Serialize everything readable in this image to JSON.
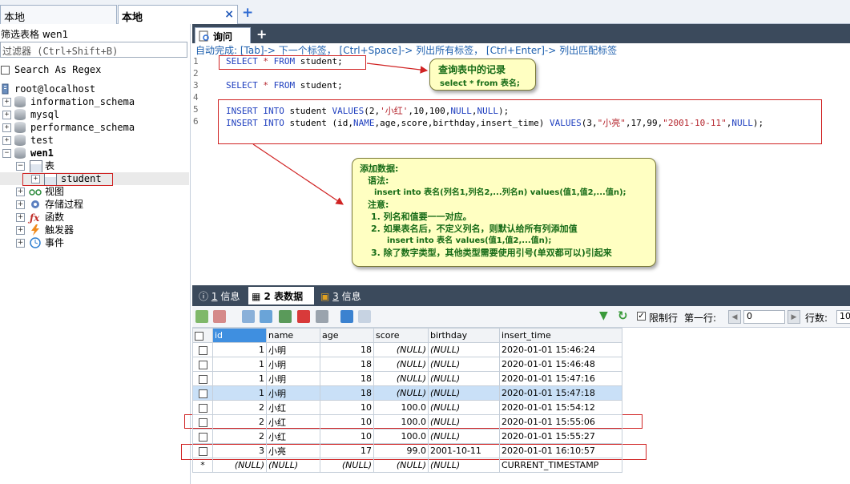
{
  "top_tabs": [
    {
      "label": "本地"
    },
    {
      "label": "本地",
      "close": "×"
    }
  ],
  "top_add": "+",
  "left": {
    "filter_label": "筛选表格 wen1",
    "filter_placeholder": "过滤器 (Ctrl+Shift+B)",
    "regex_label": "Search As Regex",
    "tree": {
      "root": "root@localhost",
      "dbs": [
        "information_schema",
        "mysql",
        "performance_schema",
        "test",
        "wen1"
      ],
      "tables_folder": "表",
      "table": "student",
      "folders": [
        "视图",
        "存储过程",
        "函数",
        "触发器",
        "事件"
      ]
    }
  },
  "editor": {
    "tab_label": "询问",
    "add": "+",
    "hint": "自动完成: [Tab]-> 下一个标签， [Ctrl+Space]-> 列出所有标签， [Ctrl+Enter]-> 列出匹配标签",
    "line_numbers": [
      "1",
      "2",
      "3",
      "4",
      "5",
      "6"
    ],
    "lines": {
      "l1a": "SELECT",
      "l1b": " * ",
      "l1c": "FROM",
      "l1d": " student;",
      "l3a": "SELECT",
      "l3b": " * ",
      "l3c": "FROM",
      "l3d": " student;",
      "l5a": "INSERT",
      "l5b": " ",
      "l5c": "INTO",
      "l5d": " student ",
      "l5e": "VALUES",
      "l5f": "(2,",
      "l5g": "'小红'",
      "l5h": ",10,100,",
      "l5i": "NULL",
      "l5j": ",",
      "l5k": "NULL",
      "l5l": ");",
      "l6a": "INSERT",
      "l6b": " ",
      "l6c": "INTO",
      "l6d": " student (id,",
      "l6e": "NAME",
      "l6f": ",age,score,birthday,insert_time) ",
      "l6g": "VALUES",
      "l6h": "(3,",
      "l6i": "\"小亮\"",
      "l6j": ",17,99,",
      "l6k": "\"2001-10-11\"",
      "l6l": ",",
      "l6m": "NULL",
      "l6n": ");"
    }
  },
  "callout1": {
    "title": "查询表中的记录",
    "body": "select * from 表名;"
  },
  "callout2": {
    "title": "添加数据:",
    "syntax": "语法:",
    "syntax_line": "insert into 表名(列名1,列名2,...列名n) values(值1,值2,...值n);",
    "note": "注意:",
    "n1": "1. 列名和值要一一对应。",
    "n2": "2. 如果表名后，不定义列名，则默认给所有列添加值",
    "n2b": "insert into 表名 values(值1,值2,...值n);",
    "n3": "3. 除了数字类型，其他类型需要使用引号(单双都可以)引起来"
  },
  "result": {
    "tabs": [
      {
        "num": "1",
        "label": "信息"
      },
      {
        "num": "2",
        "label": "表数据"
      },
      {
        "num": "3",
        "label": "信息"
      }
    ],
    "limit_label": "限制行",
    "first_row_label": "第一行:",
    "first_row_value": "0",
    "rows_label": "行数:",
    "rows_value": "10",
    "columns": [
      "id",
      "name",
      "age",
      "score",
      "birthday",
      "insert_time"
    ],
    "rows": [
      [
        "1",
        "小明",
        "18",
        "(NULL)",
        "(NULL)",
        "2020-01-01 15:46:24"
      ],
      [
        "1",
        "小明",
        "18",
        "(NULL)",
        "(NULL)",
        "2020-01-01 15:46:48"
      ],
      [
        "1",
        "小明",
        "18",
        "(NULL)",
        "(NULL)",
        "2020-01-01 15:47:16"
      ],
      [
        "1",
        "小明",
        "18",
        "(NULL)",
        "(NULL)",
        "2020-01-01 15:47:18"
      ],
      [
        "2",
        "小红",
        "10",
        "100.0",
        "(NULL)",
        "2020-01-01 15:54:12"
      ],
      [
        "2",
        "小红",
        "10",
        "100.0",
        "(NULL)",
        "2020-01-01 15:55:06"
      ],
      [
        "2",
        "小红",
        "10",
        "100.0",
        "(NULL)",
        "2020-01-01 15:55:27"
      ],
      [
        "3",
        "小亮",
        "17",
        "99.0",
        "2001-10-11",
        "2020-01-01 16:10:57"
      ]
    ],
    "new_row": [
      "*",
      "(NULL)",
      "(NULL)",
      "(NULL)",
      "(NULL)",
      "(NULL)",
      "CURRENT_TIMESTAMP"
    ]
  },
  "colors": {
    "annotation_red": "#d02323",
    "callout_bg": "#ffffc2",
    "callout_text": "#166b16",
    "header_dark": "#3b4a5c"
  }
}
